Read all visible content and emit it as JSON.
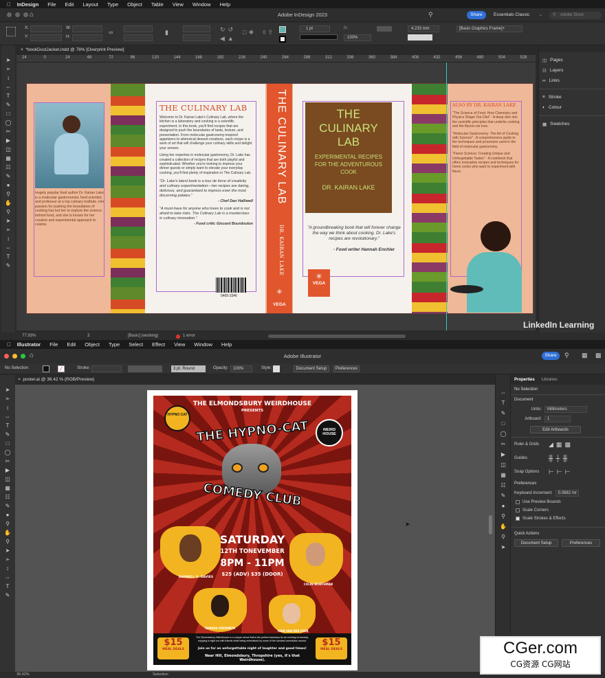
{
  "indesign": {
    "app_name": "InDesign",
    "menu": [
      "File",
      "Edit",
      "Layout",
      "Type",
      "Object",
      "Table",
      "View",
      "Window",
      "Help"
    ],
    "title": "Adobe InDesign 2023",
    "share": "Share",
    "workspace": "Essentials Classic",
    "search_placeholder": "Adobe Stock",
    "stroke_weight": "1 pt",
    "dimension": "4.233 mm",
    "zoom_pct": "100%",
    "frame_style": "[Basic Graphics Frame]+",
    "doc_tab": "*bookDustJacket.indd @ 78% [Overprint Preview]",
    "ruler_ticks": [
      "24",
      "0",
      "24",
      "48",
      "72",
      "96",
      "120",
      "144",
      "168",
      "192",
      "216",
      "240",
      "264",
      "288",
      "312",
      "336",
      "360",
      "384",
      "408",
      "432",
      "456",
      "480",
      "504",
      "528"
    ],
    "panels": [
      "Pages",
      "Layers",
      "Links",
      "Stroke",
      "Colour",
      "Swatches"
    ],
    "status": {
      "zoom": "77.93%",
      "page": "3",
      "preflight": "[Basic] (working)",
      "errors": "1 error"
    },
    "cover": {
      "flap_bio": "Hugely popular food author Dr. Kairan Lake is a molecular gastronomist, food scientist, and professor at a top culinary institute. Her passion for pushing the boundaries of cooking has led her to explore the science behind food, and she is known for her creative and experimental approach to cuisine.",
      "back_title": "THE CULINARY LAB",
      "back_body1": "Welcome to Dr. Kairan Lake's Culinary Lab, where the kitchen is a laboratory and cooking is a scientific experiment. In this book, you'll find recipes that are designed to push the boundaries of taste, texture, and presentation. From molecular gastronomy-inspired appetizers to whimsical dessert creations, each recipe is a work of art that will challenge your culinary skills and delight your senses.",
      "back_body2": "Using her expertise in molecular gastronomy, Dr. Lake has created a collection of recipes that are both playful and sophisticated. Whether you're looking to impress your dinner guests or simply want to elevate your everyday cooking, you'll find plenty of inspiration in The Culinary Lab.",
      "quote1": "\"Dr. Lake's latest book is a tour de force of creativity and culinary experimentation—her recipes are daring, delicious, and guaranteed to impress even the most discerning palates.\"",
      "quote1_by": "- Chef Dan Halliwell",
      "quote2": "\"A must-have for anyone who loves to cook and is not afraid to take risks. The Culinary Lab is a masterclass in culinary innovation.\"",
      "quote2_by": "- Food critic Giscard Bourdoulon",
      "barcode_num": "5465-3346",
      "spine_title": "THE CULINARY LAB",
      "spine_author": "DR. KAIRAN LAKE",
      "publisher": "VEGA",
      "front_title_1": "THE",
      "front_title_2": "CULINARY",
      "front_title_3": "LAB",
      "front_sub": "EXPERIMENTAL RECIPES FOR THE ADVENTUROUS COOK",
      "front_author": "DR. KAIRAN LAKE",
      "front_quote": "\"A groundbreaking book that will forever change the way we think about cooking. Dr. Lake's recipes are revolutionary.\"",
      "front_quote_by": "- Food writer Hannah Enchler",
      "also_by": "ALSO BY DR. KAIRAN LAKE",
      "also_items": [
        "\"The Science of Food: How Chemistry and Physics Shape Our Diet\" - A deep dive into the scientific principles that underlie cooking and the flavors we love.",
        "\"Molecular Gastronomy: The Art of Cooking with Science\" - A comprehensive guide to the techniques and processes used in the field of molecular gastronomy.",
        "\"Flavor Science: Creating Unique and Unforgettable Tastes\" - A cookbook that offers innovative recipes and techniques for home cooks who want to experiment with flavor."
      ]
    },
    "watermark": "LinkedIn Learning"
  },
  "illustrator": {
    "app_name": "Illustrator",
    "menu": [
      "File",
      "Edit",
      "Object",
      "Type",
      "Select",
      "Effect",
      "View",
      "Window",
      "Help"
    ],
    "title": "Adobe Illustrator",
    "share": "Share",
    "control": {
      "no_selection": "No Selection",
      "stroke_label": "Stroke:",
      "brush": "3 pt. Round",
      "opacity_label": "Opacity:",
      "opacity": "100%",
      "style_label": "Style:",
      "doc_setup": "Document Setup",
      "preferences": "Preferences"
    },
    "doc_tab": "poster.ai @ 36.42 % (RGB/Preview)",
    "status": {
      "zoom": "36.42%",
      "tool": "Selection"
    },
    "props": {
      "tab_properties": "Properties",
      "tab_libraries": "Libraries",
      "no_selection": "No Selection",
      "document": "Document",
      "units_label": "Units:",
      "units": "Millimeters",
      "artboard_label": "Artboard:",
      "artboard": "1",
      "edit_artboards": "Edit Artboards",
      "ruler_grids": "Ruler & Grids",
      "guides": "Guides",
      "snap": "Snap Options",
      "preferences": "Preferences",
      "kb_label": "Keyboard Increment:",
      "kb_value": "0.0882 mr",
      "use_preview": "Use Preview Bounds",
      "scale_corners": "Scale Corners",
      "scale_strokes": "Scale Strokes & Effects",
      "quick_actions": "Quick Actions",
      "qa_doc_setup": "Document Setup",
      "qa_prefs": "Preferences"
    },
    "poster": {
      "venue": "THE ELMONDSBURY WEIRDHOUSE",
      "presents": "PRESENTS",
      "title1": "THE HYPNO-CAT",
      "title2": "COMEDY CLUB",
      "badge_left": "HYPNO CAT",
      "badge_right": "WEIRD HOUSE",
      "day": "SATURDAY",
      "date": "12TH TONEVEMBER",
      "time": "8PM - 11PM",
      "price": "$25 (ADV) $35 (DOOR)",
      "act1": "DARNELL G. DAVIES",
      "act2": "COLIN WORTHMAN",
      "act3": "TAMARA ODENWEIK",
      "act4": "IVAN VAN DER FEER",
      "deal": "$15",
      "deal_label": "MEAL DEALS",
      "footer1": "The Elmondsbury Weirdhouse is a unique venue that is the perfect backdrop for an evening of comedy, enjoying a night out with friends while being entertained by some of the funniest comedians around.",
      "footer2": "Join us for an unforgettable night of laughter and good times!",
      "footer3": "Near Hill, Elmondsbury, Thropshire (yes, it's that Weirdhouse)."
    }
  },
  "watermark2": {
    "main": "CGer.com",
    "sub": "CG资源 CG网站"
  },
  "colors": {
    "peach": "#efb898",
    "brown": "#7a4a20",
    "orange_red": "#e1562c",
    "poster_red": "#b52a1e",
    "yellow": "#f2b420",
    "accent_blue": "#2f6fd6"
  }
}
